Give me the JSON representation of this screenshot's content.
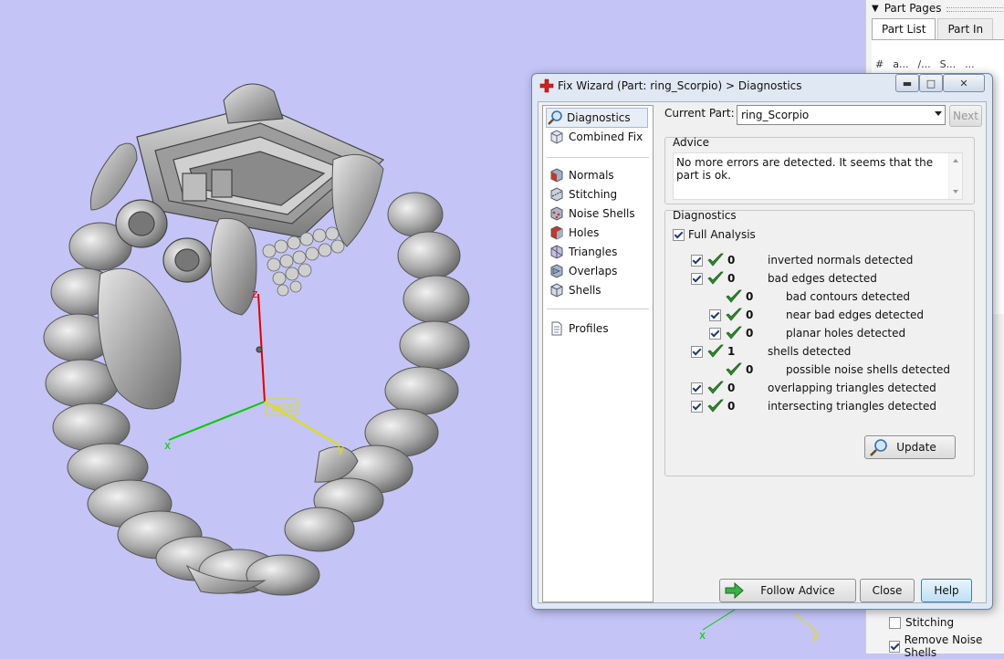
{
  "colors": {
    "viewport_bg": "#c4c4f6",
    "axis_x": "#00cc00",
    "axis_y": "#e0e000",
    "axis_z": "#e00000",
    "ok_check": "#2e8b2e"
  },
  "viewport": {
    "wcs_label": "WCS",
    "axis_x_label": "x",
    "axis_y_label": "y",
    "axis_z_label": "z"
  },
  "right_panel": {
    "header": "Part Pages",
    "tabs": [
      {
        "label": "Part List"
      },
      {
        "label": "Part In"
      }
    ],
    "column_headers": [
      "#",
      "a...",
      "/...",
      "S...",
      "..."
    ],
    "checkboxes": [
      {
        "label": "Stitching",
        "checked": false
      },
      {
        "label": "Remove Noise Shells",
        "checked": true
      }
    ]
  },
  "dialog": {
    "title": "Fix Wizard (Part: ring_Scorpio) > Diagnostics",
    "nav": {
      "group1": [
        {
          "label": "Diagnostics",
          "icon": "magnifier-icon",
          "selected": true
        },
        {
          "label": "Combined Fix",
          "icon": "cube-icon"
        }
      ],
      "group2": [
        {
          "label": "Normals",
          "icon": "normals-icon"
        },
        {
          "label": "Stitching",
          "icon": "stitching-icon"
        },
        {
          "label": "Noise Shells",
          "icon": "noise-shells-icon"
        },
        {
          "label": "Holes",
          "icon": "holes-icon"
        },
        {
          "label": "Triangles",
          "icon": "triangles-icon"
        },
        {
          "label": "Overlaps",
          "icon": "overlaps-icon"
        },
        {
          "label": "Shells",
          "icon": "shells-icon"
        }
      ],
      "group3": [
        {
          "label": "Profiles",
          "icon": "document-icon"
        }
      ]
    },
    "current_part_label": "Current Part:",
    "current_part_value": "ring_Scorpio",
    "next_label": "Next",
    "advice": {
      "title": "Advice",
      "text": "No more errors are detected. It seems that the part is ok."
    },
    "diagnostics": {
      "title": "Diagnostics",
      "full_analysis_label": "Full Analysis",
      "full_analysis_checked": true,
      "rows": [
        {
          "checkbox": true,
          "count": "0",
          "text": "inverted normals detected",
          "indent": 0
        },
        {
          "checkbox": true,
          "count": "0",
          "text": "bad edges detected",
          "indent": 0
        },
        {
          "checkbox": false,
          "count": "0",
          "text": "bad contours detected",
          "indent": 1
        },
        {
          "checkbox": true,
          "count": "0",
          "text": "near bad edges detected",
          "indent": 1
        },
        {
          "checkbox": true,
          "count": "0",
          "text": "planar holes detected",
          "indent": 1
        },
        {
          "checkbox": true,
          "count": "1",
          "text": "shells detected",
          "indent": 0
        },
        {
          "checkbox": false,
          "count": "0",
          "text": "possible noise shells detected",
          "indent": 1
        },
        {
          "checkbox": true,
          "count": "0",
          "text": "overlapping triangles detected",
          "indent": 0
        },
        {
          "checkbox": true,
          "count": "0",
          "text": "intersecting triangles detected",
          "indent": 0
        }
      ],
      "update_label": "Update"
    },
    "buttons": {
      "follow_advice": "Follow Advice",
      "close": "Close",
      "help": "Help"
    }
  }
}
